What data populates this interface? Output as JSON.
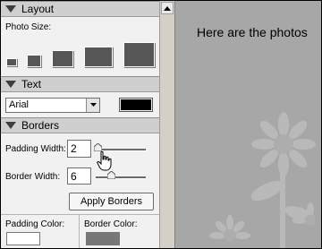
{
  "sections": {
    "layout": {
      "title": "Layout",
      "photo_size_label": "Photo Size:"
    },
    "text": {
      "title": "Text",
      "font_value": "Arial",
      "color": "#000000"
    },
    "borders": {
      "title": "Borders",
      "padding_width_label": "Padding Width:",
      "padding_width_value": "2",
      "border_width_label": "Border Width:",
      "border_width_value": "6",
      "apply_label": "Apply Borders",
      "padding_color_label": "Padding Color:",
      "border_color_label": "Border Color:",
      "padding_color": "#ffffff",
      "border_color": "#777777"
    }
  },
  "preview": {
    "text": "Here are the photos"
  }
}
